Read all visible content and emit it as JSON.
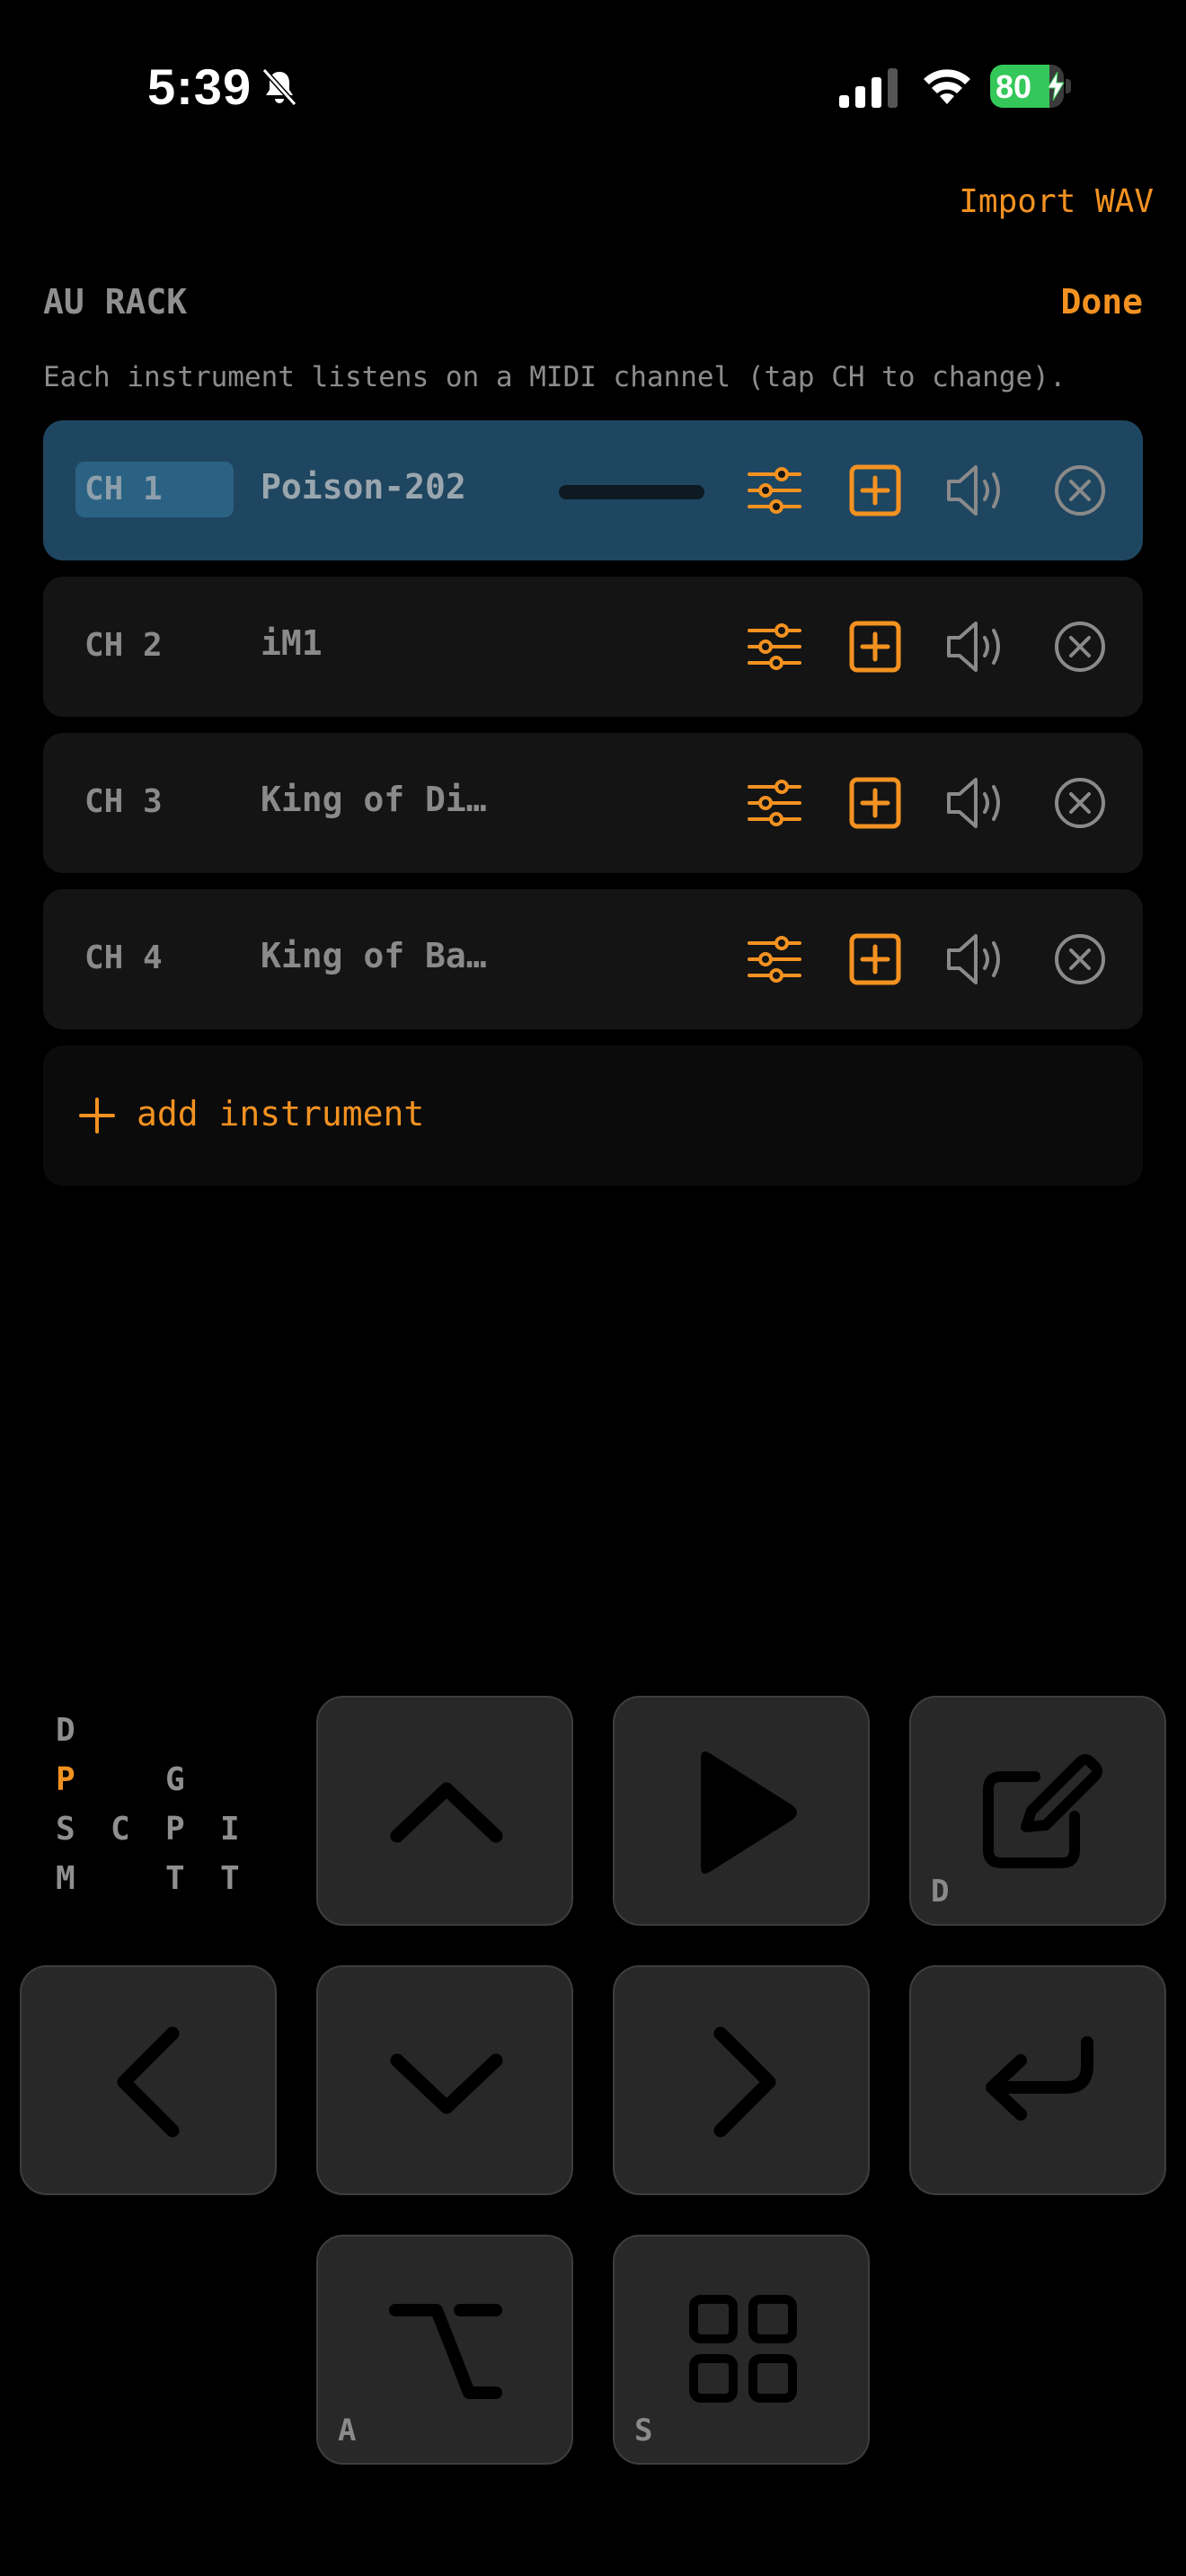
{
  "status_bar": {
    "time": "5:39",
    "battery_percent": 80,
    "battery_label": "80",
    "icons": [
      "bell-slash-icon",
      "cellular-signal-icon",
      "wifi-icon",
      "battery-charging-icon"
    ]
  },
  "header": {
    "import_label": "Import WAV",
    "title": "AU RACK",
    "done_label": "Done",
    "hint": "Each instrument listens on a MIDI channel (tap CH to change)."
  },
  "rack": {
    "rows": [
      {
        "channel": "CH 1",
        "name": "Poison-202",
        "selected": true
      },
      {
        "channel": "CH 2",
        "name": "iM1",
        "selected": false
      },
      {
        "channel": "CH 3",
        "name": "King of Di…",
        "selected": false
      },
      {
        "channel": "CH 4",
        "name": "King of Ba…",
        "selected": false
      }
    ],
    "row_icons": [
      "sliders-icon",
      "plus-square-icon",
      "speaker-icon",
      "remove-circle-icon"
    ],
    "add_label": "add instrument"
  },
  "mode_grid": {
    "letters": [
      "D",
      "P",
      "G",
      "S",
      "C",
      "P",
      "I",
      "M",
      "T",
      "T"
    ],
    "active": "P"
  },
  "keys": {
    "up": {
      "icon": "chevron-up-icon",
      "hint": ""
    },
    "play": {
      "icon": "play-icon",
      "hint": ""
    },
    "edit": {
      "icon": "edit-icon",
      "hint": "D"
    },
    "left": {
      "icon": "chevron-left-icon",
      "hint": ""
    },
    "down": {
      "icon": "chevron-down-icon",
      "hint": ""
    },
    "right": {
      "icon": "chevron-right-icon",
      "hint": ""
    },
    "enter": {
      "icon": "return-icon",
      "hint": ""
    },
    "option": {
      "icon": "option-key-icon",
      "hint": "A"
    },
    "grid": {
      "icon": "grid-icon",
      "hint": "S"
    }
  },
  "colors": {
    "accent": "#f39221",
    "selected_row": "#1f4660",
    "row": "#141414",
    "key": "#282828",
    "battery": "#34c759"
  }
}
